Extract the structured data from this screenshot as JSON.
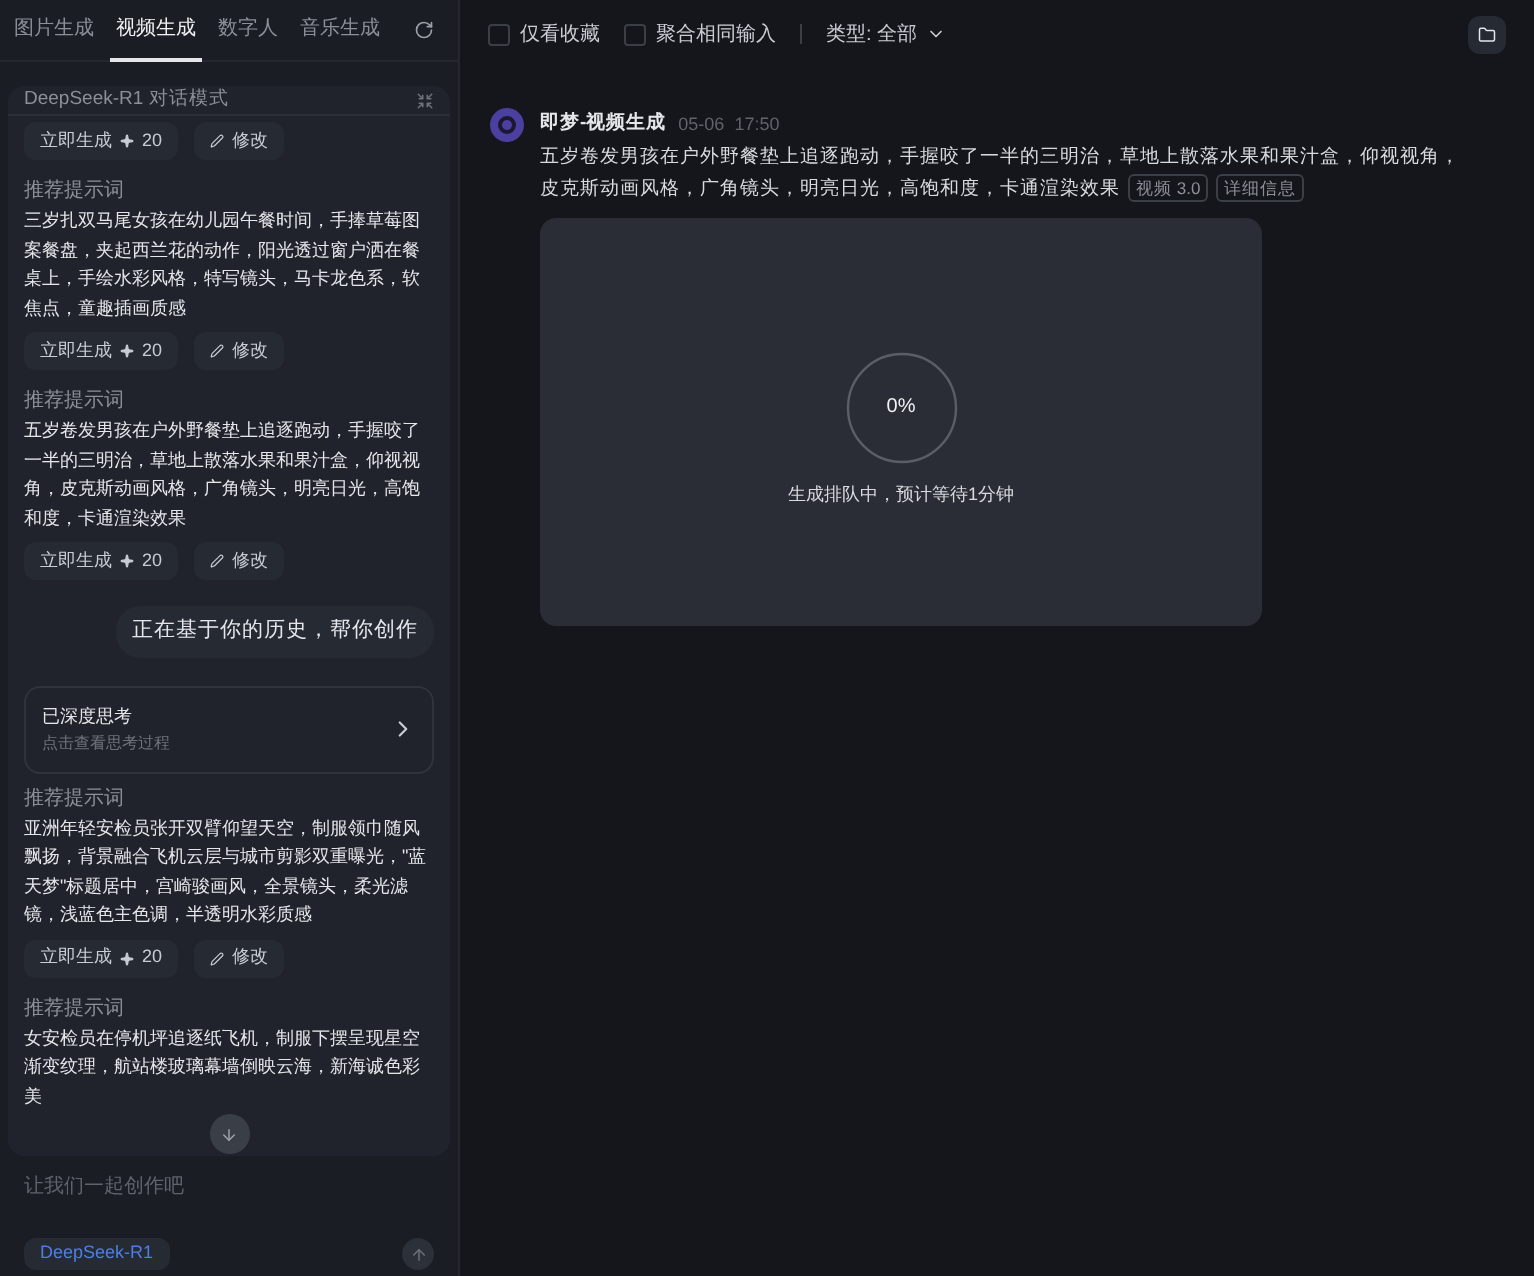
{
  "tabs": [
    {
      "label": "图片生成",
      "selected": false
    },
    {
      "label": "视频生成",
      "selected": true
    },
    {
      "label": "数字人",
      "selected": false
    },
    {
      "label": "音乐生成",
      "selected": false
    }
  ],
  "chat": {
    "title": "DeepSeek-R1 对话模式",
    "items": [
      {
        "kind": "actions",
        "generate": "立即生成",
        "cost": "20",
        "edit": "修改"
      },
      {
        "kind": "prompt",
        "label": "推荐提示词",
        "text": "三岁扎双马尾女孩在幼儿园午餐时间，手捧草莓图案餐盘，夹起西兰花的动作，阳光透过窗户洒在餐桌上，手绘水彩风格，特写镜头，马卡龙色系，软焦点，童趣插画质感"
      },
      {
        "kind": "actions",
        "generate": "立即生成",
        "cost": "20",
        "edit": "修改"
      },
      {
        "kind": "prompt",
        "label": "推荐提示词",
        "text": "五岁卷发男孩在户外野餐垫上追逐跑动，手握咬了一半的三明治，草地上散落水果和果汁盒，仰视视角，皮克斯动画风格，广角镜头，明亮日光，高饱和度，卡通渲染效果"
      },
      {
        "kind": "actions",
        "generate": "立即生成",
        "cost": "20",
        "edit": "修改"
      },
      {
        "kind": "user",
        "text": "正在基于你的历史，帮你创作"
      },
      {
        "kind": "thinking",
        "title": "已深度思考",
        "subtitle": "点击查看思考过程"
      },
      {
        "kind": "prompt",
        "label": "推荐提示词",
        "text": "亚洲年轻安检员张开双臂仰望天空，制服领巾随风飘扬，背景融合飞机云层与城市剪影双重曝光，\"蓝天梦\"标题居中，宫崎骏画风，全景镜头，柔光滤镜，浅蓝色主色调，半透明水彩质感"
      },
      {
        "kind": "actions",
        "generate": "立即生成",
        "cost": "20",
        "edit": "修改"
      },
      {
        "kind": "prompt",
        "label": "推荐提示词",
        "text": "女安检员在停机坪追逐纸飞机，制服下摆呈现星空渐变纹理，航站楼玻璃幕墙倒映云海，新海诚色彩美"
      }
    ]
  },
  "input": {
    "placeholder": "让我们一起创作吧",
    "model": "DeepSeek-R1"
  },
  "toolbar": {
    "filters": [
      {
        "label": "仅看收藏",
        "checked": false
      },
      {
        "label": "聚合相同输入",
        "checked": false
      }
    ],
    "type": "类型: 全部"
  },
  "message": {
    "author": "即梦-视频生成",
    "time": "05-06  17:50",
    "text": "五岁卷发男孩在户外野餐垫上追逐跑动，手握咬了一半的三明治，草地上散落水果和果汁盒，仰视视角，皮克斯动画风格，广角镜头，明亮日光，高饱和度，卡通渲染效果",
    "tags": [
      "视频 3.0",
      "详细信息"
    ],
    "progress": {
      "level": 0,
      "reading": "0%",
      "status": "生成排队中，预计等待1分钟"
    }
  }
}
